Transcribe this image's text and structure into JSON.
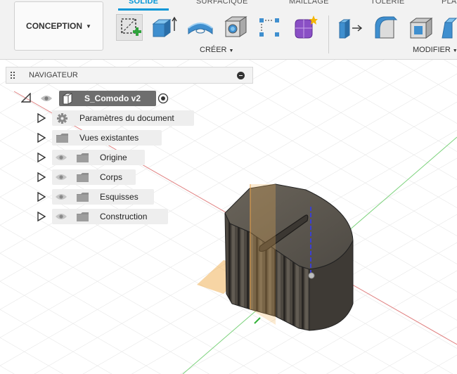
{
  "workspace": {
    "label": "CONCEPTION"
  },
  "tabs": [
    {
      "label": "SOLIDE",
      "active": true
    },
    {
      "label": "SURFACIQUE",
      "active": false
    },
    {
      "label": "MAILLAGE",
      "active": false
    },
    {
      "label": "TÔLERIE",
      "active": false
    },
    {
      "label": "PLA",
      "active": false
    }
  ],
  "groups": {
    "create": {
      "label": "CRÉER"
    },
    "modify": {
      "label": "MODIFIER"
    }
  },
  "tools": {
    "create": [
      "new-sketch-icon",
      "extrude-icon",
      "revolve-icon",
      "hole-icon",
      "pattern-icon",
      "create-form-icon"
    ],
    "modify": [
      "press-pull-icon",
      "fillet-icon",
      "shell-icon",
      "draft-icon"
    ]
  },
  "navigator": {
    "title": "NAVIGATEUR",
    "root": {
      "label": "S_Comodo v2"
    },
    "items": [
      {
        "label": "Paramètres du document",
        "icon": "gear-icon",
        "eye": false
      },
      {
        "label": "Vues existantes",
        "icon": "folder-icon",
        "eye": false
      },
      {
        "label": "Origine",
        "icon": "folder-icon",
        "eye": true
      },
      {
        "label": "Corps",
        "icon": "folder-icon",
        "eye": true
      },
      {
        "label": "Esquisses",
        "icon": "folder-icon",
        "eye": true
      },
      {
        "label": "Construction",
        "icon": "folder-icon",
        "eye": true
      }
    ]
  },
  "colors": {
    "accent": "#0696d7",
    "selected_root": "#6e6e6e",
    "body": "#555048",
    "sketch_plane": "#f0b25a"
  }
}
